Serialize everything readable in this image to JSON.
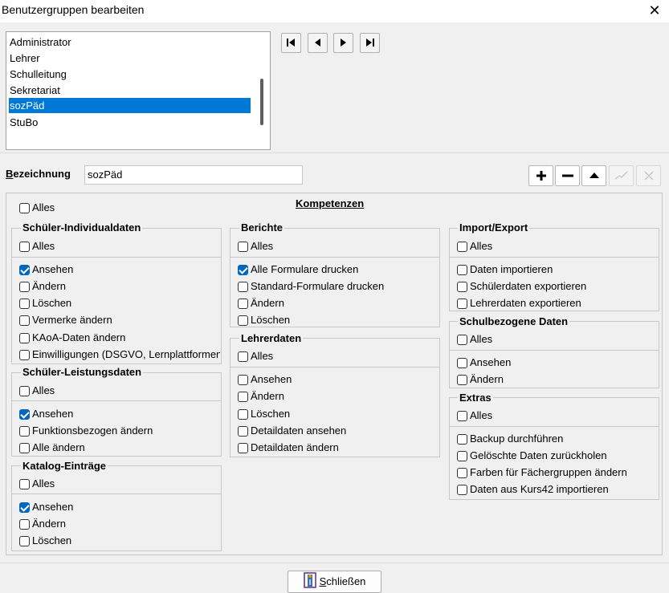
{
  "window": {
    "title": "Benutzergruppen bearbeiten",
    "close_glyph": "✕"
  },
  "groups_list": {
    "items": [
      "Administrator",
      "Lehrer",
      "Schulleitung",
      "Sekretariat",
      "sozPäd",
      "StuBo"
    ],
    "selected": "sozPäd"
  },
  "nav_buttons": [
    "first-record-icon",
    "previous-record-icon",
    "next-record-icon",
    "last-record-icon"
  ],
  "bezeichnung": {
    "label_first": "B",
    "label_rest": "ezeichnung",
    "value": "sozPäd"
  },
  "toolbar_icons": [
    "add-icon",
    "remove-icon",
    "move-up-icon",
    "confirm-icon",
    "cancel-icon"
  ],
  "panel": {
    "title": "Kompetenzen",
    "all_label": "Alles"
  },
  "sections": {
    "schueler_individual": {
      "title": "Schüler-Individualdaten",
      "all": "Alles",
      "items": [
        "Ansehen",
        "Ändern",
        "Löschen",
        "Vermerke ändern",
        "KAoA-Daten ändern",
        "Einwilligungen (DSGVO, Lernplattformen)"
      ]
    },
    "schueler_leistung": {
      "title": "Schüler-Leistungsdaten",
      "all": "Alles",
      "items": [
        "Ansehen",
        "Funktionsbezogen ändern",
        "Alle ändern"
      ]
    },
    "katalog": {
      "title": "Katalog-Einträge",
      "all": "Alles",
      "items": [
        "Ansehen",
        "Ändern",
        "Löschen"
      ]
    },
    "berichte": {
      "title": "Berichte",
      "all": "Alles",
      "items": [
        "Alle Formulare drucken",
        "Standard-Formulare drucken",
        "Ändern",
        "Löschen"
      ]
    },
    "lehrerdaten": {
      "title": "Lehrerdaten",
      "all": "Alles",
      "items": [
        "Ansehen",
        "Ändern",
        "Löschen",
        "Detaildaten ansehen",
        "Detaildaten ändern"
      ]
    },
    "import_export": {
      "title": "Import/Export",
      "all": "Alles",
      "items": [
        "Daten importieren",
        "Schülerdaten exportieren",
        "Lehrerdaten exportieren"
      ]
    },
    "schulbezogen": {
      "title": "Schulbezogene Daten",
      "all": "Alles",
      "items": [
        "Ansehen",
        "Ändern"
      ]
    },
    "extras": {
      "title": "Extras",
      "all": "Alles",
      "items": [
        "Backup durchführen",
        "Gelöschte Daten zurückholen",
        "Farben für Fächergruppen ändern",
        "Daten aus Kurs42 importieren"
      ]
    }
  },
  "close_button": {
    "label_first": "S",
    "label_rest": "chließen",
    "icon": "door-exit-icon"
  },
  "colors": {
    "selection": "#0078d7",
    "checkbox_checked": "#0067c0"
  }
}
